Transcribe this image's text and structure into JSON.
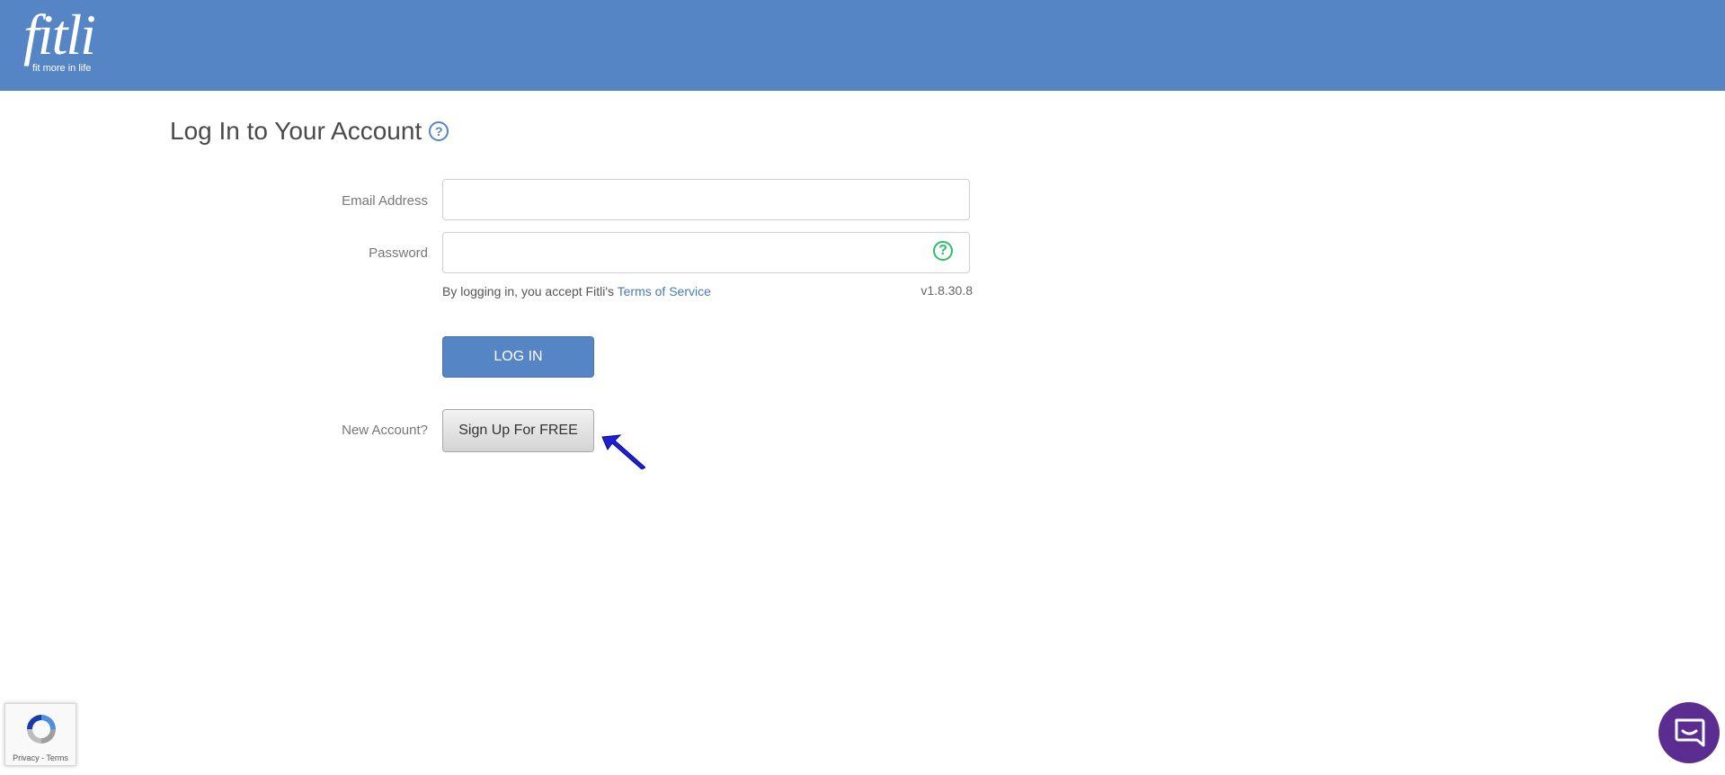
{
  "brand": {
    "logo_text": "fitli",
    "tagline": "fit more in life",
    "accent_color": "#5585c5"
  },
  "page": {
    "title": "Log In to Your Account",
    "title_help_icon": "help-circle-icon"
  },
  "form": {
    "email_label": "Email Address",
    "email_value": "",
    "password_label": "Password",
    "password_value": "",
    "password_help_icon": "help-circle-icon",
    "tos_prefix": "By logging in, you accept Fitli's ",
    "tos_link": "Terms of Service",
    "version": "v1.8.30.8",
    "login_button": "LOG IN",
    "new_account_label": "New Account?",
    "signup_button": "Sign Up For FREE"
  },
  "recaptcha": {
    "privacy": "Privacy",
    "separator": " - ",
    "terms": "Terms"
  },
  "chat": {
    "icon": "chat-bubble-icon"
  }
}
